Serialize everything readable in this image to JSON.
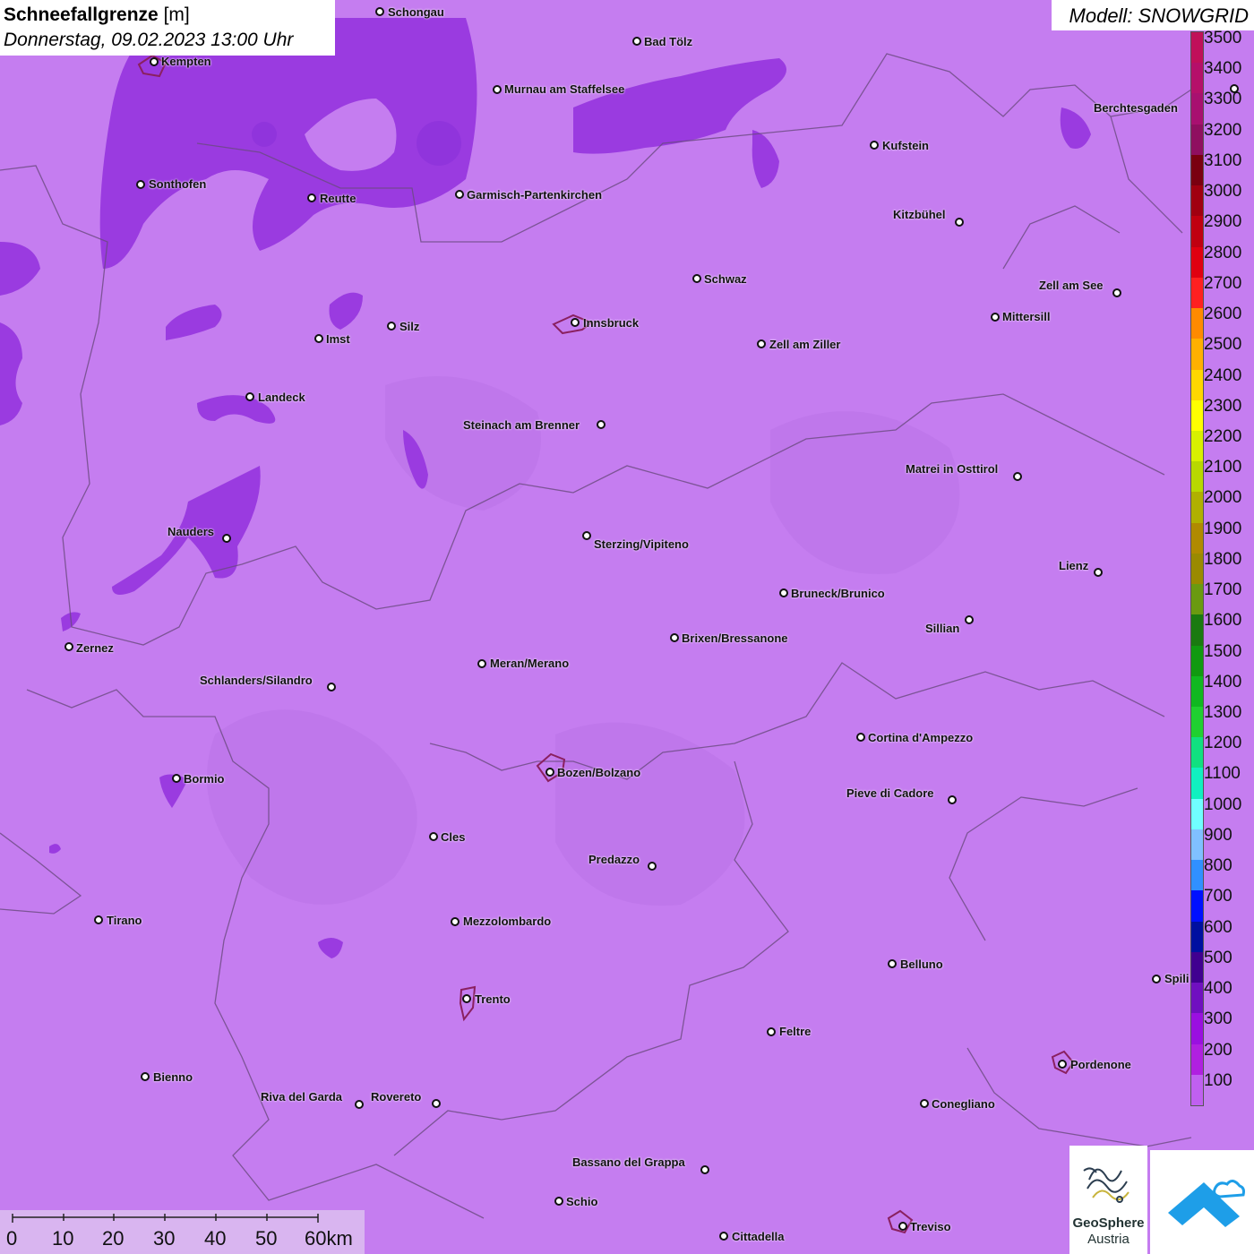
{
  "title": {
    "label": "Schneefallgrenze",
    "unit": "[m]",
    "datetime": "Donnerstag, 09.02.2023 13:00 Uhr"
  },
  "model": "Modell: SNOWGRID",
  "legend": {
    "values": [
      "3500",
      "3400",
      "3300",
      "3200",
      "3100",
      "3000",
      "2900",
      "2800",
      "2700",
      "2600",
      "2500",
      "2400",
      "2300",
      "2200",
      "2100",
      "2000",
      "1900",
      "1800",
      "1700",
      "1600",
      "1500",
      "1400",
      "1300",
      "1200",
      "1100",
      "1000",
      "900",
      "800",
      "700",
      "600",
      "500",
      "400",
      "300",
      "200",
      "100"
    ],
    "colors": [
      "#c0105a",
      "#b5106a",
      "#a81070",
      "#8f0f60",
      "#7a0010",
      "#a00010",
      "#c00010",
      "#e00010",
      "#ff2020",
      "#ff8a00",
      "#ffb000",
      "#ffd700",
      "#ffff00",
      "#d8f000",
      "#b8d800",
      "#b0b000",
      "#b08a00",
      "#9a8a00",
      "#6a9a10",
      "#1a7a10",
      "#109a10",
      "#10b820",
      "#20d030",
      "#10e080",
      "#10f0c0",
      "#70ffff",
      "#80c0ff",
      "#3090ff",
      "#0010ff",
      "#0010a0",
      "#400090",
      "#7010c0",
      "#9a10e0",
      "#b020e0",
      "#c060f0"
    ]
  },
  "cities": [
    {
      "name": "Schongau"
    },
    {
      "name": "Bad Tölz"
    },
    {
      "name": "Kempten"
    },
    {
      "name": "Murnau am Staffelsee"
    },
    {
      "name": "Berchtesgaden"
    },
    {
      "name": "Kufstein"
    },
    {
      "name": "Sonthofen"
    },
    {
      "name": "Reutte"
    },
    {
      "name": "Garmisch-Partenkirchen"
    },
    {
      "name": "Kitzbühel"
    },
    {
      "name": "Schwaz"
    },
    {
      "name": "Zell am See"
    },
    {
      "name": "Mittersill"
    },
    {
      "name": "Innsbruck"
    },
    {
      "name": "Silz"
    },
    {
      "name": "Imst"
    },
    {
      "name": "Zell am Ziller"
    },
    {
      "name": "Landeck"
    },
    {
      "name": "Steinach am Brenner"
    },
    {
      "name": "Matrei in Osttirol"
    },
    {
      "name": "Nauders"
    },
    {
      "name": "Sterzing/Vipiteno"
    },
    {
      "name": "Lienz"
    },
    {
      "name": "Bruneck/Brunico"
    },
    {
      "name": "Sillian"
    },
    {
      "name": "Brixen/Bressanone"
    },
    {
      "name": "Zernez"
    },
    {
      "name": "Meran/Merano"
    },
    {
      "name": "Schlanders/Silandro"
    },
    {
      "name": "Cortina d'Ampezzo"
    },
    {
      "name": "Bozen/Bolzano"
    },
    {
      "name": "Bormio"
    },
    {
      "name": "Pieve di Cadore"
    },
    {
      "name": "Cles"
    },
    {
      "name": "Predazzo"
    },
    {
      "name": "Tirano"
    },
    {
      "name": "Mezzolombardo"
    },
    {
      "name": "Belluno"
    },
    {
      "name": "Spili"
    },
    {
      "name": "Trento"
    },
    {
      "name": "Feltre"
    },
    {
      "name": "Pordenone"
    },
    {
      "name": "Bienno"
    },
    {
      "name": "Riva del Garda"
    },
    {
      "name": "Rovereto"
    },
    {
      "name": "Conegliano"
    },
    {
      "name": "Bassano del Grappa"
    },
    {
      "name": "Schio"
    },
    {
      "name": "Treviso"
    },
    {
      "name": "Cittadella"
    }
  ],
  "scalebar": {
    "labels": [
      "0",
      "10",
      "20",
      "30",
      "40",
      "50",
      "60km"
    ]
  },
  "logos": {
    "geosphere_line1": "GeoSphere",
    "geosphere_line2": "Austria",
    "geosphere_icon": "geosphere-logo-icon",
    "app_icon": "mountain-cloud-logo-icon"
  }
}
